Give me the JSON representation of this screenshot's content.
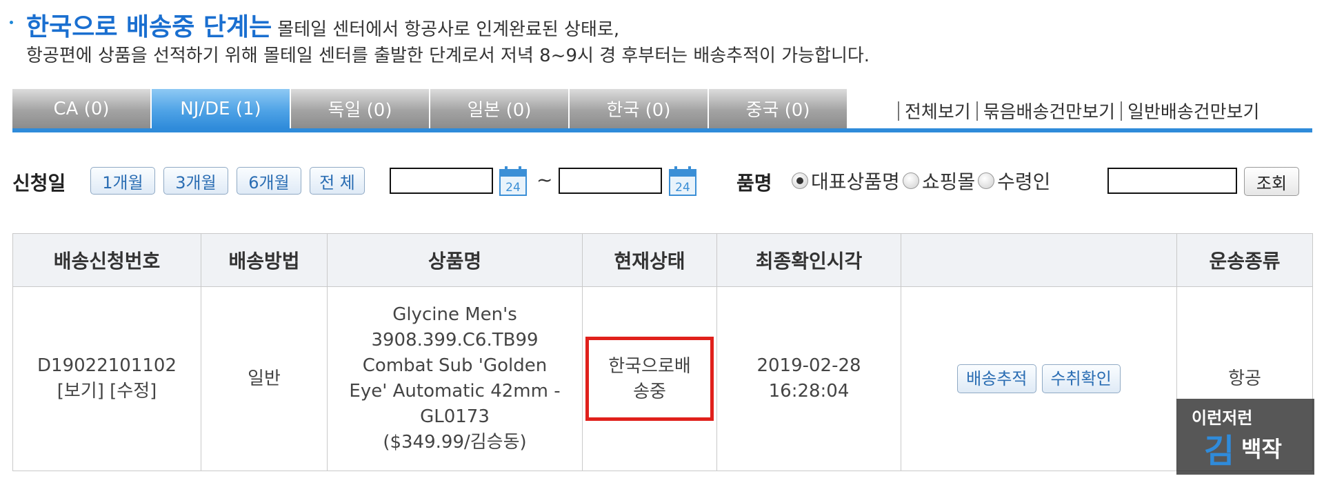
{
  "notice": {
    "headline": "한국으로 배송중 단계는",
    "lead": "몰테일 센터에서 항공사로 인계완료된 상태로,",
    "line2": "항공편에 상품을 선적하기 위해 몰테일 센터를 출발한 단계로서 저녁 8~9시 경 후부터는 배송추적이 가능합니다."
  },
  "tabs": [
    {
      "label": "CA (0)",
      "active": false
    },
    {
      "label": "NJ/DE (1)",
      "active": true
    },
    {
      "label": "독일 (0)",
      "active": false
    },
    {
      "label": "일본 (0)",
      "active": false
    },
    {
      "label": "한국 (0)",
      "active": false
    },
    {
      "label": "중국 (0)",
      "active": false
    }
  ],
  "views": {
    "all": "전체보기",
    "bundled": "묶음배송건만보기",
    "regular": "일반배송건만보기"
  },
  "filter": {
    "date_label": "신청일",
    "periods": [
      "1개월",
      "3개월",
      "6개월",
      "전 체"
    ],
    "tilde": "~",
    "calendar_day": "24",
    "item_label": "품명",
    "radios": [
      {
        "label": "대표상품명",
        "checked": true
      },
      {
        "label": "쇼핑몰",
        "checked": false
      },
      {
        "label": "수령인",
        "checked": false
      }
    ],
    "search_button": "조회"
  },
  "table": {
    "headers": [
      "배송신청번호",
      "배송방법",
      "상품명",
      "현재상태",
      "최종확인시각",
      "",
      "운송종류"
    ],
    "row": {
      "order_no": "D19022101102",
      "view_link": "[보기]",
      "edit_link": "[수정]",
      "method": "일반",
      "product_lines": [
        "Glycine Men's",
        "3908.399.C6.TB99",
        "Combat Sub 'Golden",
        "Eye' Automatic 42mm -",
        "GL0173",
        "($349.99/김승동)"
      ],
      "status_lines": [
        "한국으로배",
        "송중"
      ],
      "time_date": "2019-02-28",
      "time_clock": "16:28:04",
      "track_button": "배송추적",
      "confirm_button": "수취확인",
      "transport": "항공"
    }
  },
  "watermark": {
    "top_text": "이런저런",
    "big_char": "김",
    "rest_text": "백작"
  },
  "colors": {
    "headline_blue": "#1a6fd0",
    "tab_active": "#4fa3e6",
    "underline": "#2f8bda",
    "status_border": "#e0201b"
  }
}
